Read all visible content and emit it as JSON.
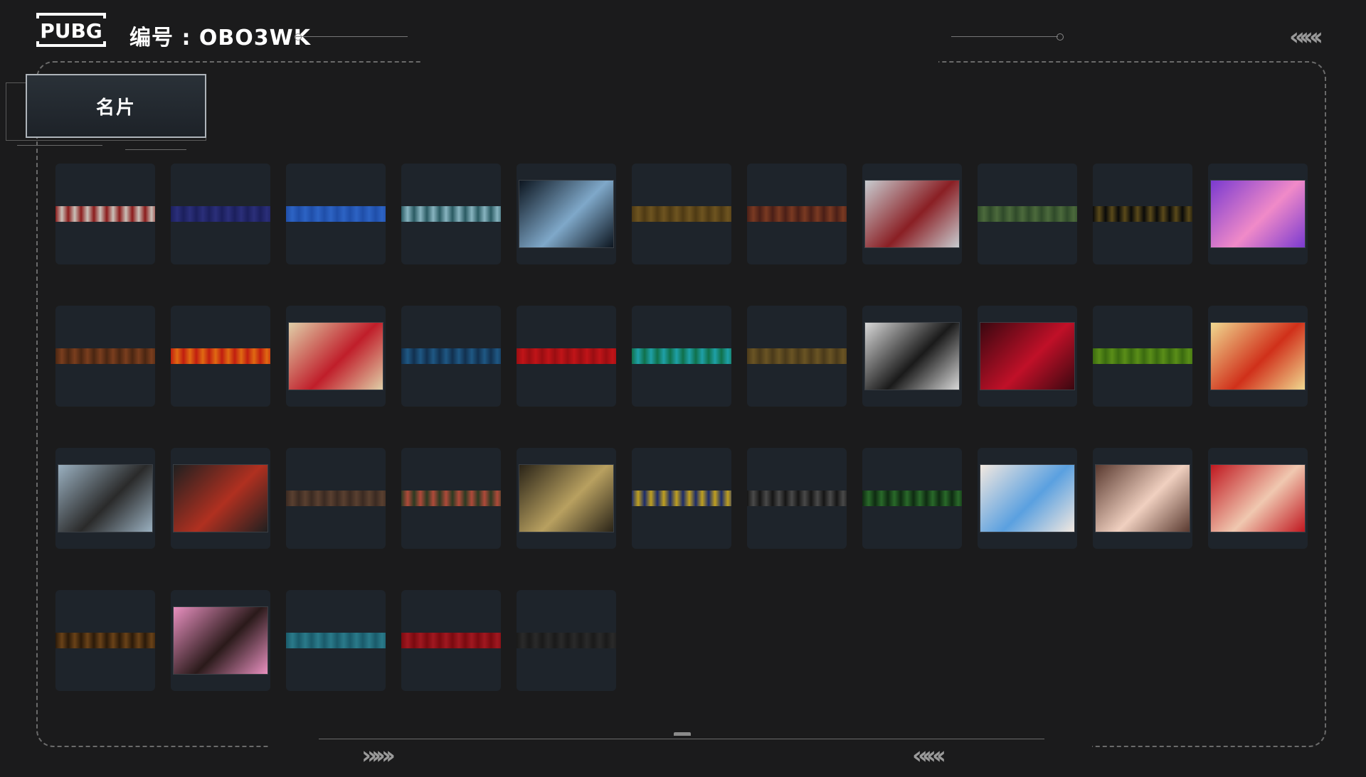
{
  "header": {
    "logo_text": "PUBG",
    "id_label": "编号 :",
    "id_value": "OBO3WK",
    "chevrons_right": "«‹«‹"
  },
  "tab": {
    "label": "名片"
  },
  "footer": {
    "chevrons_left": "»›»›",
    "chevrons_right": "«‹«‹"
  },
  "cards": [
    {
      "kind": "strip",
      "c1": "#8b1b1b",
      "c2": "#c9c0b8",
      "name": "red-white-pattern"
    },
    {
      "kind": "strip",
      "c1": "#1b1f5c",
      "c2": "#2b2f7a",
      "name": "navy-paisley"
    },
    {
      "kind": "strip",
      "c1": "#1f4ea8",
      "c2": "#2d63c4",
      "name": "blue-paisley"
    },
    {
      "kind": "strip",
      "c1": "#2a5a62",
      "c2": "#88b4c0",
      "name": "teal-lion"
    },
    {
      "kind": "photo",
      "c1": "#0d1620",
      "c2": "#7fa8c9",
      "name": "sports-car"
    },
    {
      "kind": "strip",
      "c1": "#4e3a14",
      "c2": "#6e5420",
      "name": "gold-pattern"
    },
    {
      "kind": "strip",
      "c1": "#4a1f17",
      "c2": "#7a3a22",
      "name": "brown-swirl"
    },
    {
      "kind": "photo",
      "c1": "#c8ccd0",
      "c2": "#8a1f24",
      "name": "figure-skater"
    },
    {
      "kind": "strip",
      "c1": "#2f4a2a",
      "c2": "#4c6a3c",
      "name": "green-camo"
    },
    {
      "kind": "strip",
      "c1": "#0a0a0a",
      "c2": "#5a4a1a",
      "name": "black-gold"
    },
    {
      "kind": "photo",
      "c1": "#7a3ad0",
      "c2": "#f08ac8",
      "name": "anime-cat-girl"
    },
    {
      "kind": "strip",
      "c1": "#4a2612",
      "c2": "#7a3e1e",
      "name": "orange-ornament"
    },
    {
      "kind": "strip",
      "c1": "#c01e10",
      "c2": "#e06a12",
      "name": "red-orange"
    },
    {
      "kind": "photo",
      "c1": "#e0cfa8",
      "c2": "#c01e2a",
      "name": "red-gadget"
    },
    {
      "kind": "strip",
      "c1": "#12304e",
      "c2": "#1f5884",
      "name": "blue-texture"
    },
    {
      "kind": "strip",
      "c1": "#9a0e12",
      "c2": "#c01418",
      "name": "red-texture"
    },
    {
      "kind": "strip",
      "c1": "#10704a",
      "c2": "#1fa0a8",
      "name": "green-teal"
    },
    {
      "kind": "strip",
      "c1": "#4a3a1a",
      "c2": "#6a5424",
      "name": "brown-lace"
    },
    {
      "kind": "photo",
      "c1": "#d8d8d8",
      "c2": "#1a1a1a",
      "name": "woman-portrait"
    },
    {
      "kind": "photo",
      "c1": "#3a0810",
      "c2": "#c01028",
      "name": "red-neon-figure"
    },
    {
      "kind": "strip",
      "c1": "#3a6a10",
      "c2": "#5a8e18",
      "name": "green-scales"
    },
    {
      "kind": "photo",
      "c1": "#f0d890",
      "c2": "#d0301a",
      "name": "bang-comic"
    },
    {
      "kind": "photo",
      "c1": "#9ab0c0",
      "c2": "#2a2a2a",
      "name": "fighter-girl"
    },
    {
      "kind": "photo",
      "c1": "#202020",
      "c2": "#b03020",
      "name": "masked-man"
    },
    {
      "kind": "strip",
      "c1": "#3a2a22",
      "c2": "#5a4030",
      "name": "brown-pattern"
    },
    {
      "kind": "strip",
      "c1": "#2a3a22",
      "c2": "#b04a3a",
      "name": "shark-camo"
    },
    {
      "kind": "photo",
      "c1": "#2a2418",
      "c2": "#b8a060",
      "name": "golden-gears"
    },
    {
      "kind": "strip",
      "c1": "#1a2a6a",
      "c2": "#c0a020",
      "name": "blue-yellow"
    },
    {
      "kind": "strip",
      "c1": "#151515",
      "c2": "#4a4a4a",
      "name": "black-lace"
    },
    {
      "kind": "strip",
      "c1": "#0e2a12",
      "c2": "#2a6a2a",
      "name": "green-eye"
    },
    {
      "kind": "photo",
      "c1": "#f2e8e0",
      "c2": "#5aa0e0",
      "name": "anime-white-hair"
    },
    {
      "kind": "photo",
      "c1": "#5a3a30",
      "c2": "#f0d0c0",
      "name": "anime-brown-hair"
    },
    {
      "kind": "photo",
      "c1": "#c01820",
      "c2": "#f0c8b0",
      "name": "anime-red-hair"
    },
    {
      "kind": "strip",
      "c1": "#2a1a0a",
      "c2": "#6a4218",
      "name": "brown-wood"
    },
    {
      "kind": "photo",
      "c1": "#e890c0",
      "c2": "#2a1a1a",
      "name": "girl-pink-hat"
    },
    {
      "kind": "strip",
      "c1": "#1a5a6a",
      "c2": "#2a7a8a",
      "name": "teal-strip"
    },
    {
      "kind": "strip",
      "c1": "#7a0a10",
      "c2": "#a01820",
      "name": "red-diamond"
    },
    {
      "kind": "strip",
      "c1": "#1a1a1a",
      "c2": "#2a2a2a",
      "name": "dark-strip"
    }
  ]
}
